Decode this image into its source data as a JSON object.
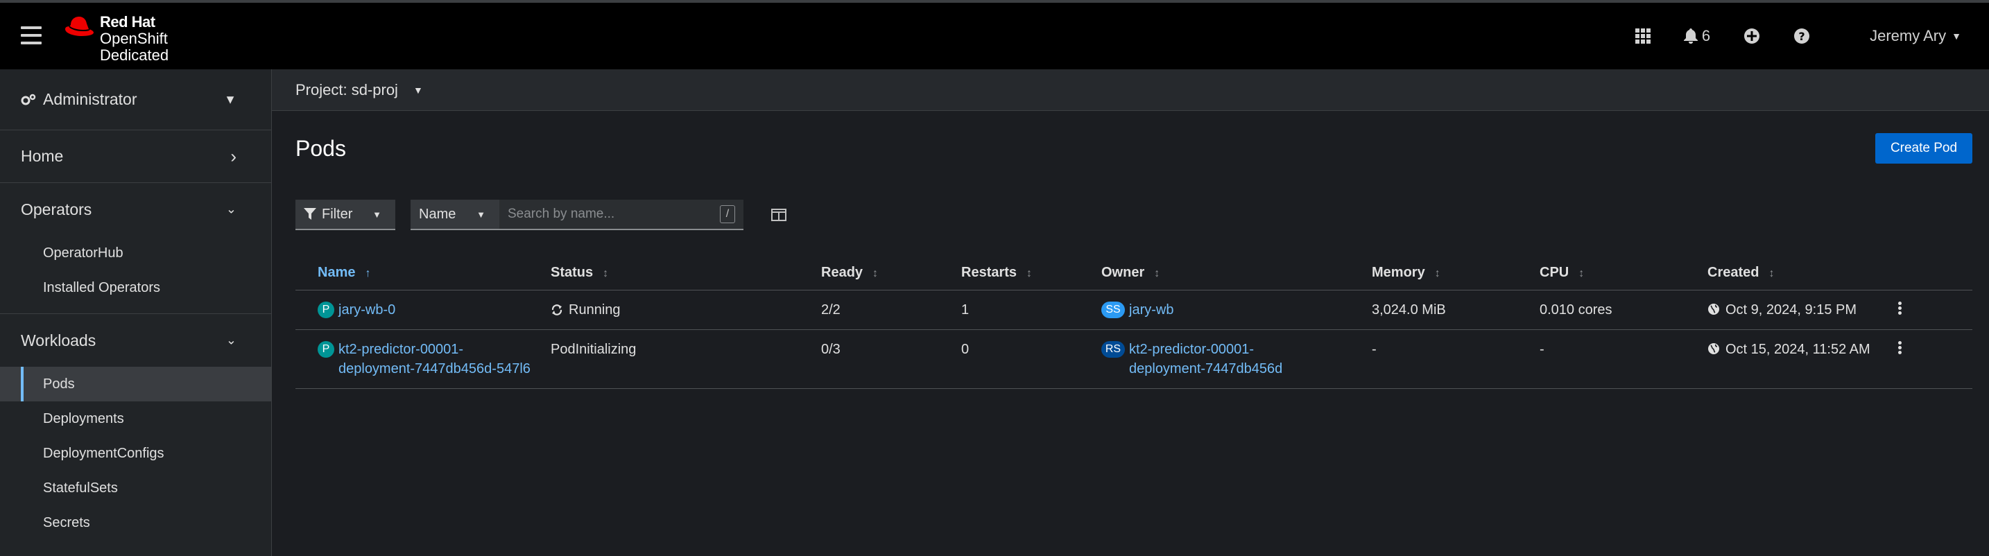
{
  "brand": {
    "line1": "Red Hat",
    "line2": "OpenShift",
    "line3": "Dedicated"
  },
  "header": {
    "notification_count": "6",
    "user_name": "Jeremy Ary"
  },
  "sidebar": {
    "perspective": "Administrator",
    "sections": [
      {
        "label": "Home"
      },
      {
        "label": "Operators",
        "items": [
          "OperatorHub",
          "Installed Operators"
        ]
      },
      {
        "label": "Workloads",
        "items": [
          "Pods",
          "Deployments",
          "DeploymentConfigs",
          "StatefulSets",
          "Secrets"
        ]
      }
    ]
  },
  "project": {
    "label": "Project: sd-proj"
  },
  "page": {
    "title": "Pods",
    "create_label": "Create Pod"
  },
  "toolbar": {
    "filter_label": "Filter",
    "attribute_label": "Name",
    "search_placeholder": "Search by name...",
    "shortcut_key": "/"
  },
  "table": {
    "columns": [
      "Name",
      "Status",
      "Ready",
      "Restarts",
      "Owner",
      "Memory",
      "CPU",
      "Created"
    ],
    "rows": [
      {
        "name": "jary-wb-0",
        "name_badge": "P",
        "status": "Running",
        "ready": "2/2",
        "restarts": "1",
        "owner_badge": "SS",
        "owner": "jary-wb",
        "memory": "3,024.0 MiB",
        "cpu": "0.010 cores",
        "created": "Oct 9, 2024, 9:15 PM"
      },
      {
        "name": "kt2-predictor-00001-deployment-7447db456d-547l6",
        "name_line1": "kt2-predictor-00001-",
        "name_line2": "deployment-7447db456d-547l6",
        "name_badge": "P",
        "status": "PodInitializing",
        "ready": "0/3",
        "restarts": "0",
        "owner_badge": "RS",
        "owner_line1": "kt2-predictor-00001-",
        "owner_line2": "deployment-7447db456d",
        "memory": "-",
        "cpu": "-",
        "created": "Oct 15, 2024, 11:52 AM"
      }
    ]
  },
  "colors": {
    "accent": "#0066cc",
    "link": "#73bcf7",
    "pod_badge": "#009596",
    "ss_badge": "#2b9af3",
    "rs_badge": "#004b95"
  }
}
